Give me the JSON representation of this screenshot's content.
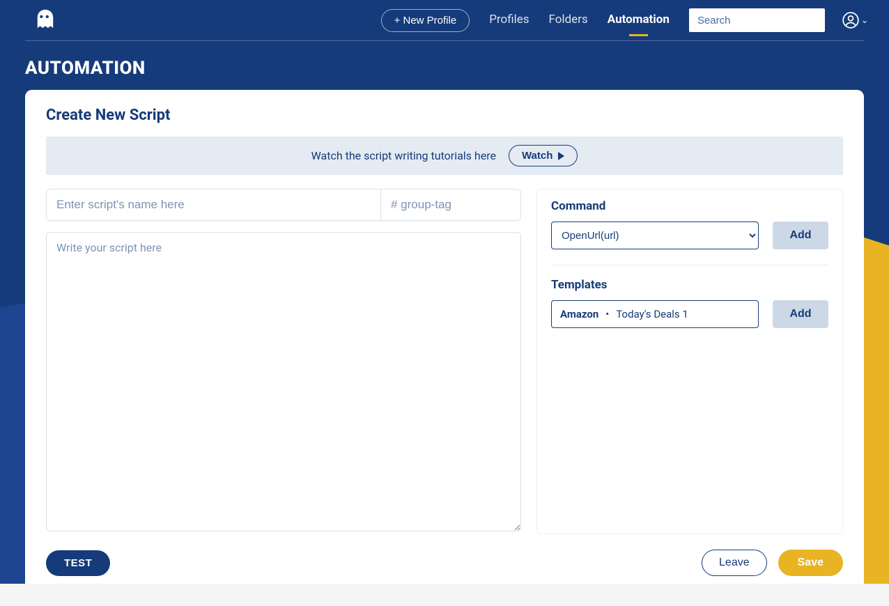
{
  "colors": {
    "primary": "#163b7a",
    "accent": "#e8b423"
  },
  "header": {
    "new_profile_label": "+ New Profile",
    "nav": {
      "profiles": "Profiles",
      "folders": "Folders",
      "automation": "Automation"
    },
    "search_placeholder": "Search"
  },
  "page": {
    "title": "AUTOMATION",
    "card_title": "Create New Script"
  },
  "tutorial": {
    "text": "Watch the script writing tutorials here",
    "button": "Watch"
  },
  "inputs": {
    "script_name_placeholder": "Enter script's name here",
    "group_tag_placeholder": "# group-tag",
    "script_body_placeholder": "Write your script here"
  },
  "sidebar": {
    "command_label": "Command",
    "command_selected": "OpenUrl(url)",
    "command_add": "Add",
    "templates_label": "Templates",
    "template_site": "Amazon",
    "template_name": "Today's Deals 1",
    "template_add": "Add"
  },
  "footer": {
    "test": "TEST",
    "leave": "Leave",
    "save": "Save"
  }
}
